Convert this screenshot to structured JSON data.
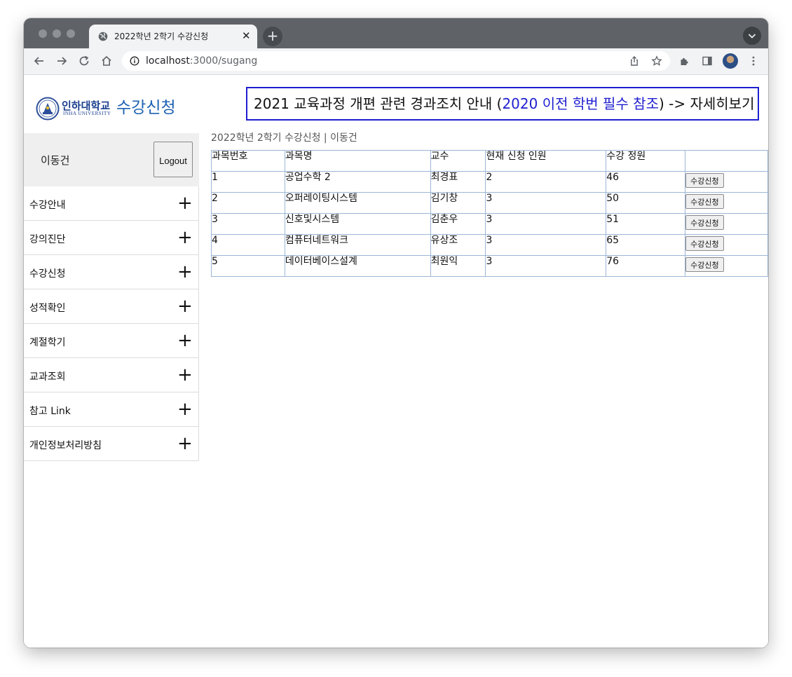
{
  "browser": {
    "tab_title": "2022학년 2학기 수강신청",
    "tab_close": "✕",
    "new_tab": "+",
    "url_host": "localhost",
    "url_path": ":3000/sugang"
  },
  "header": {
    "logo_kr": "인하대학교",
    "logo_en": "INHA UNIVERSITY",
    "site_title": "수강신청",
    "notice_prefix": "2021 교육과정 개편 관련 경과조치 안내 (",
    "notice_highlight": "2020 이전 학번 필수 참조",
    "notice_suffix": ") -> 자세히보기",
    "notice_highlight_color": "#1e1ecf"
  },
  "sidebar": {
    "user_name": "이동건",
    "logout_label": "Logout",
    "items": [
      {
        "label": "수강안내",
        "icon": "plus-icon"
      },
      {
        "label": "강의진단",
        "icon": "plus-icon"
      },
      {
        "label": "수강신청",
        "icon": "plus-icon"
      },
      {
        "label": "성적확인",
        "icon": "plus-icon"
      },
      {
        "label": "계절학기",
        "icon": "plus-icon"
      },
      {
        "label": "교과조회",
        "icon": "plus-icon"
      },
      {
        "label": "참고 Link",
        "icon": "plus-icon"
      },
      {
        "label": "개인정보처리방침",
        "icon": "plus-icon"
      }
    ],
    "plus_glyph": "+"
  },
  "main": {
    "breadcrumb": "2022학년 2학기 수강신청 | 이동건",
    "table": {
      "columns": [
        "과목번호",
        "과목명",
        "교수",
        "현재 신청 인원",
        "수강 정원",
        ""
      ],
      "rows": [
        {
          "id": "1",
          "name": "공업수학 2",
          "professor": "최경표",
          "current": "2",
          "capacity": "46",
          "action": "수강신청"
        },
        {
          "id": "2",
          "name": "오퍼레이팅시스템",
          "professor": "김기창",
          "current": "3",
          "capacity": "50",
          "action": "수강신청"
        },
        {
          "id": "3",
          "name": "신호및시스템",
          "professor": "김춘우",
          "current": "3",
          "capacity": "51",
          "action": "수강신청"
        },
        {
          "id": "4",
          "name": "컴퓨터네트워크",
          "professor": "유상조",
          "current": "3",
          "capacity": "65",
          "action": "수강신청"
        },
        {
          "id": "5",
          "name": "데이터베이스설계",
          "professor": "최원익",
          "current": "3",
          "capacity": "76",
          "action": "수강신청"
        }
      ]
    }
  }
}
